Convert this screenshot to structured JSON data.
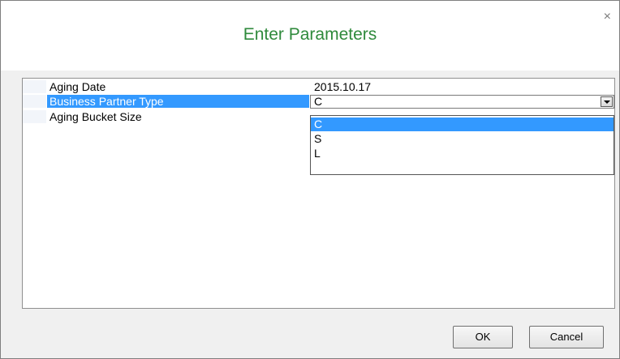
{
  "dialog": {
    "title": "Enter Parameters",
    "close_glyph": "×"
  },
  "params": [
    {
      "label": "Aging Date",
      "value": "2015.10.17"
    },
    {
      "label": "Business Partner Type",
      "value": "C"
    },
    {
      "label": "Aging Bucket Size",
      "value": ""
    }
  ],
  "dropdown": {
    "options": [
      "C",
      "S",
      "L"
    ],
    "highlighted": "C"
  },
  "buttons": {
    "ok": "OK",
    "cancel": "Cancel"
  },
  "colors": {
    "title": "#2f8a3c",
    "selection": "#3399ff"
  },
  "icons": {
    "close": "close-icon",
    "dropdown": "chevron-down-icon"
  }
}
